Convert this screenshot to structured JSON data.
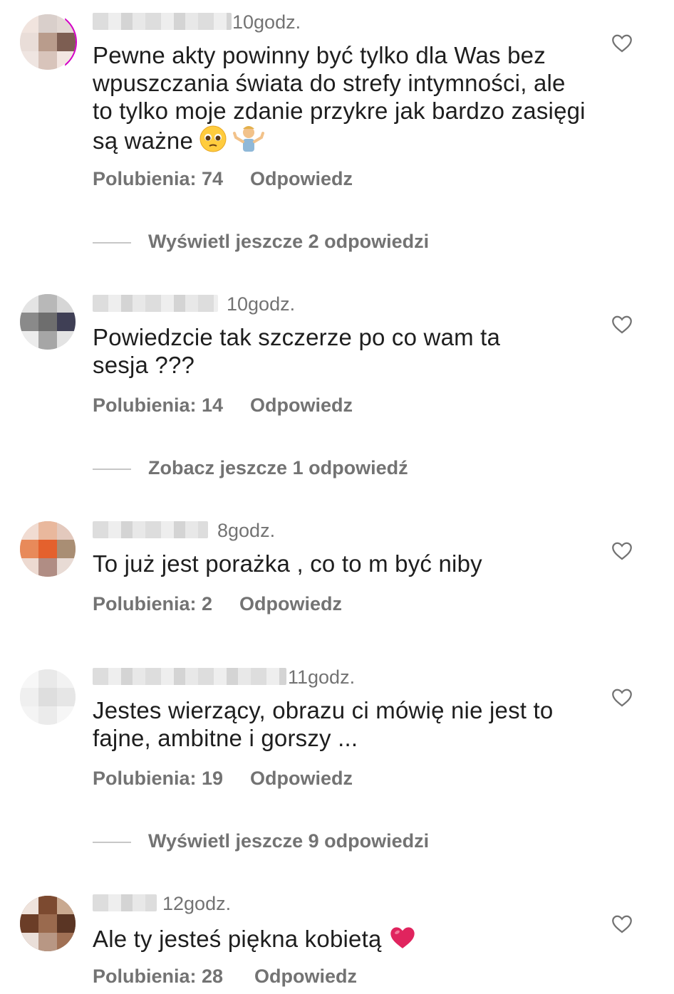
{
  "comments": [
    {
      "time": "10godz.",
      "text": "Pewne akty powinny być tylko dla Was bez wpuszczania świata do strefy intymności, ale to tylko moje zdanie przykre jak bardzo zasięgi są ważne",
      "likes": "Polubienia: 74",
      "reply": "Odpowiedz",
      "more_replies": "Wyświetl jeszcze 2 odpowiedzi",
      "emojis": [
        "pleading-face-icon",
        "person-shrugging-icon"
      ]
    },
    {
      "time": "10godz.",
      "text": "Powiedzcie tak szczerze po co wam ta sesja ???",
      "likes": "Polubienia: 14",
      "reply": "Odpowiedz",
      "more_replies": "Zobacz jeszcze 1 odpowiedź"
    },
    {
      "time": "8godz.",
      "text": "To już jest porażka , co to m być niby",
      "likes": "Polubienia: 2",
      "reply": "Odpowiedz"
    },
    {
      "time": "11godz.",
      "text": "Jestes wierzący, obrazu ci mówię nie jest to fajne,  ambitne i gorszy ...",
      "likes": "Polubienia: 19",
      "reply": "Odpowiedz",
      "more_replies": "Wyświetl jeszcze 9 odpowiedzi"
    },
    {
      "time": "12godz.",
      "text": "Ale ty jesteś piękna kobietą",
      "likes": "Polubienia: 28",
      "reply": "Odpowiedz",
      "emojis": [
        "red-heart-icon"
      ]
    }
  ],
  "icons": {
    "like": "heart-outline-icon"
  },
  "colors": {
    "meta": "#737373",
    "story_ring": "#d300c5",
    "heart_emoji": "#e0245e"
  }
}
